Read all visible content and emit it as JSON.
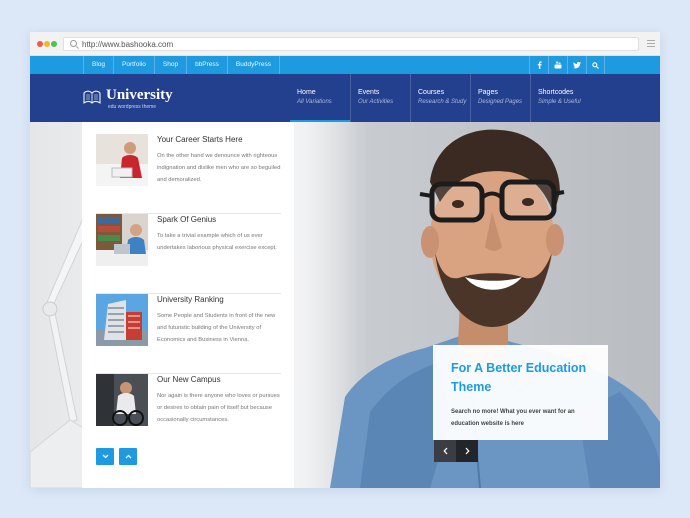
{
  "browser": {
    "url": "http://www.bashooka.com"
  },
  "topbar": {
    "links": [
      "Blog",
      "Portfolio",
      "Shop",
      "bbPress",
      "BuddyPress"
    ],
    "socials": [
      "facebook-icon",
      "youtube-icon",
      "twitter-icon",
      "search-icon"
    ]
  },
  "header": {
    "logo": {
      "name": "University",
      "tagline": "edu wordpress theme"
    },
    "nav": [
      {
        "title": "Home",
        "subtitle": "All Variations"
      },
      {
        "title": "Events",
        "subtitle": "Our Activities"
      },
      {
        "title": "Courses",
        "subtitle": "Research & Study"
      },
      {
        "title": "Pages",
        "subtitle": "Designed Pages"
      },
      {
        "title": "Shortcodes",
        "subtitle": "Simple & Useful"
      }
    ]
  },
  "panel": {
    "cards": [
      {
        "title": "Your Career Starts Here",
        "desc": "On the other hand we denounce with righteous indignation and dislike men who are so beguiled and demoralized."
      },
      {
        "title": "Spark Of Genius",
        "desc": "To take a trivial example which of us ever undertakes laborious physical exercise except."
      },
      {
        "title": "University Ranking",
        "desc": "Some People and Students in front of the new and futuristic building of the University of Economics and Business in Vienna."
      },
      {
        "title": "Our New Campus",
        "desc": "Nor again is there anyone who loves or pursues or desires to obtain pain of itself but because occasionally circumstances."
      }
    ]
  },
  "slide": {
    "heading": "For A Better Education Theme",
    "text": "Search no more! What you ever want for an education website is here"
  },
  "colors": {
    "accent": "#1e9be0",
    "header": "#23408f",
    "background": "#dce8f7"
  }
}
